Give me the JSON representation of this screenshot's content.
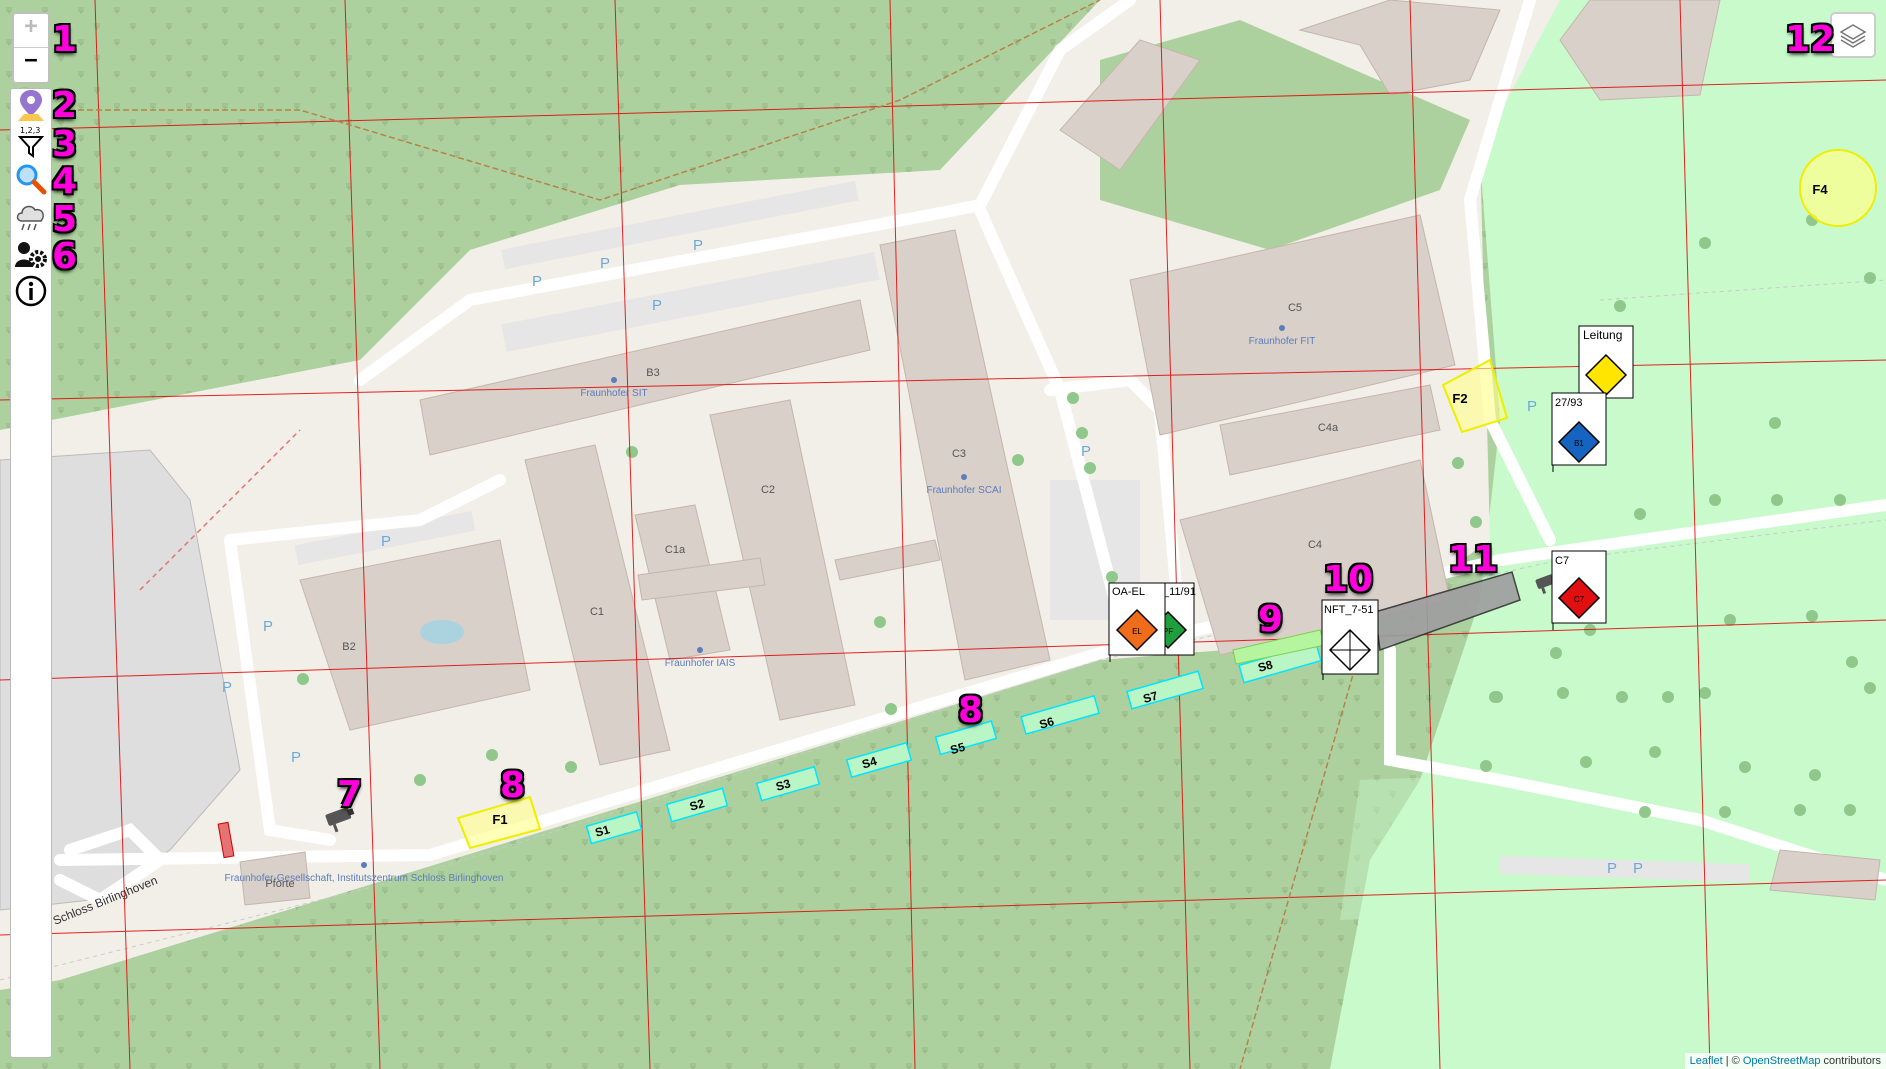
{
  "controls": {
    "zoom_in": "+",
    "zoom_out": "−"
  },
  "sidebar": {
    "tools": [
      {
        "icon": "map-marker-icon",
        "number": "2"
      },
      {
        "icon": "filter-icon",
        "number": "3"
      },
      {
        "icon": "search-icon",
        "number": "4"
      },
      {
        "icon": "weather-cloud-icon",
        "number": "5"
      },
      {
        "icon": "users-gear-icon",
        "number": "6"
      },
      {
        "icon": "info-icon",
        "number": ""
      }
    ],
    "zoom_number": "1"
  },
  "callouts": [
    "7",
    "8",
    "8",
    "9",
    "10",
    "11",
    "12"
  ],
  "buildings": [
    "B2",
    "B3",
    "C1",
    "C1a",
    "C2",
    "C3",
    "C4",
    "C4a",
    "C5",
    "Pforte"
  ],
  "institutes": {
    "sit": "Fraunhofer SIT",
    "scai": "Fraunhofer SCAI",
    "iais": "Fraunhofer IAIS",
    "fit": "Fraunhofer FIT",
    "campus": "Fraunhofer-Gesellschaft, Institutszentrum Schloss Birlinghoven"
  },
  "street": "Schloss Birlinghoven",
  "parking": "P",
  "zones": {
    "sectors": [
      "S1",
      "S2",
      "S3",
      "S4",
      "S5",
      "S6",
      "S7",
      "S8"
    ],
    "areas": [
      "F1",
      "F2",
      "F4"
    ]
  },
  "units": [
    {
      "title": "Leitung",
      "code": "",
      "color": "#ffe500"
    },
    {
      "title": "27/93",
      "code": "B1",
      "color": "#1565c0"
    },
    {
      "title": "C7",
      "code": "C7",
      "color": "#e01010"
    },
    {
      "title": "OA-EL",
      "code": "EL",
      "color": "#ef6c1a"
    },
    {
      "title": "_11/91",
      "code": "PF",
      "color": "#1e9e3c"
    },
    {
      "title": "NFT_7-51",
      "code": "",
      "color": "#ffffff"
    }
  ],
  "attribution": {
    "leaflet": "Leaflet",
    "separator": " | © ",
    "osm": "OpenStreetMap",
    "suffix": " contributors"
  },
  "colors": {
    "forest": "#add19e",
    "park": "#c8facc",
    "campus_ground": "#f2efe9",
    "building": "#d9d0c9",
    "grid_line": "#e00000",
    "callout": "#ff00dd",
    "sector_outline": "#00e5ff",
    "area_yellow": "#ffff66"
  }
}
